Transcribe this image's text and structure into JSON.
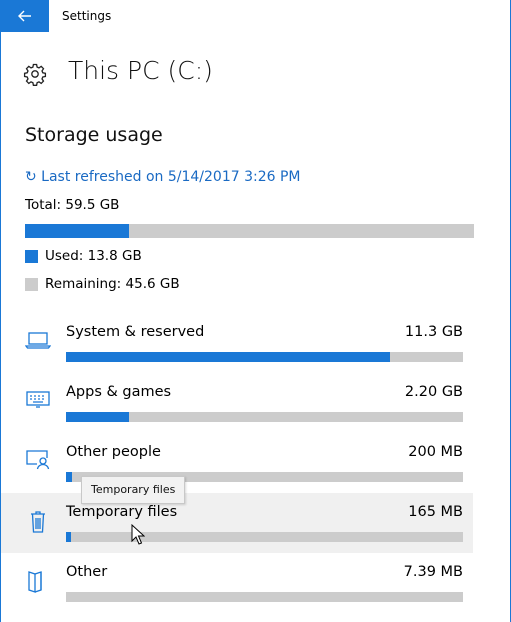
{
  "window": {
    "title": "Settings"
  },
  "header": {
    "title": "This PC (C:)"
  },
  "storage": {
    "section_title": "Storage usage",
    "refresh_text": "↻ Last refreshed on 5/14/2017 3:26 PM",
    "total_text": "Total: 59.5 GB",
    "used_fraction": 0.232,
    "used_text": "Used: 13.8 GB",
    "remaining_text": "Remaining: 45.6 GB"
  },
  "categories": [
    {
      "label": "System & reserved",
      "size": "11.3 GB",
      "fraction": 0.817,
      "icon": "laptop-icon"
    },
    {
      "label": "Apps & games",
      "size": "2.20 GB",
      "fraction": 0.159,
      "icon": "keyboard-icon"
    },
    {
      "label": "Other people",
      "size": "200 MB",
      "fraction": 0.014,
      "icon": "user-screen-icon"
    },
    {
      "label": "Temporary files",
      "size": "165 MB",
      "fraction": 0.012,
      "icon": "trash-icon"
    },
    {
      "label": "Other",
      "size": "7.39 MB",
      "fraction": 0.0,
      "icon": "map-icon"
    }
  ],
  "tooltip": {
    "text": "Temporary files"
  },
  "colors": {
    "accent": "#1a78d6",
    "link": "#1a6ac3",
    "track": "#cccccc",
    "hover_bg": "#f0f0f0"
  }
}
